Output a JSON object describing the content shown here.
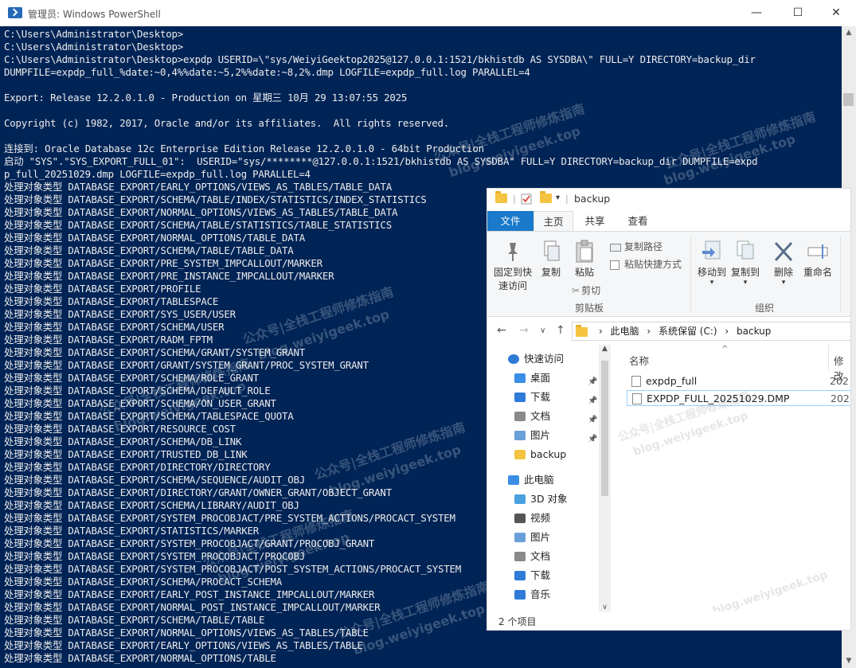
{
  "powershell": {
    "title": "管理员: Windows PowerShell",
    "controls": {
      "minimize": "—",
      "maximize": "☐",
      "close": "✕"
    },
    "lines": [
      "C:\\Users\\Administrator\\Desktop>",
      "C:\\Users\\Administrator\\Desktop>",
      "C:\\Users\\Administrator\\Desktop>expdp USERID=\\\"sys/WeiyiGeektop2025@127.0.0.1:1521/bkhistdb AS SYSDBA\\\" FULL=Y DIRECTORY=backup_dir",
      "DUMPFILE=expdp_full_%date:~0,4%%date:~5,2%%date:~8,2%.dmp LOGFILE=expdp_full.log PARALLEL=4",
      "",
      "Export: Release 12.2.0.1.0 - Production on 星期三 10月 29 13:07:55 2025",
      "",
      "Copyright (c) 1982, 2017, Oracle and/or its affiliates.  All rights reserved.",
      "",
      "连接到: Oracle Database 12c Enterprise Edition Release 12.2.0.1.0 - 64bit Production",
      "启动 \"SYS\".\"SYS_EXPORT_FULL_01\":  USERID=\"sys/********@127.0.0.1:1521/bkhistdb AS SYSDBA\" FULL=Y DIRECTORY=backup_dir DUMPFILE=expd",
      "p_full_20251029.dmp LOGFILE=expdp_full.log PARALLEL=4",
      "处理对象类型 DATABASE_EXPORT/EARLY_OPTIONS/VIEWS_AS_TABLES/TABLE_DATA",
      "处理对象类型 DATABASE_EXPORT/SCHEMA/TABLE/INDEX/STATISTICS/INDEX_STATISTICS",
      "处理对象类型 DATABASE_EXPORT/NORMAL_OPTIONS/VIEWS_AS_TABLES/TABLE_DATA",
      "处理对象类型 DATABASE_EXPORT/SCHEMA/TABLE/STATISTICS/TABLE_STATISTICS",
      "处理对象类型 DATABASE_EXPORT/NORMAL_OPTIONS/TABLE_DATA",
      "处理对象类型 DATABASE_EXPORT/SCHEMA/TABLE/TABLE_DATA",
      "处理对象类型 DATABASE_EXPORT/PRE_SYSTEM_IMPCALLOUT/MARKER",
      "处理对象类型 DATABASE_EXPORT/PRE_INSTANCE_IMPCALLOUT/MARKER",
      "处理对象类型 DATABASE_EXPORT/PROFILE",
      "处理对象类型 DATABASE_EXPORT/TABLESPACE",
      "处理对象类型 DATABASE_EXPORT/SYS_USER/USER",
      "处理对象类型 DATABASE_EXPORT/SCHEMA/USER",
      "处理对象类型 DATABASE_EXPORT/RADM_FPTM",
      "处理对象类型 DATABASE_EXPORT/SCHEMA/GRANT/SYSTEM_GRANT",
      "处理对象类型 DATABASE_EXPORT/GRANT/SYSTEM_GRANT/PROC_SYSTEM_GRANT",
      "处理对象类型 DATABASE_EXPORT/SCHEMA/ROLE_GRANT",
      "处理对象类型 DATABASE_EXPORT/SCHEMA/DEFAULT_ROLE",
      "处理对象类型 DATABASE_EXPORT/SCHEMA/ON_USER_GRANT",
      "处理对象类型 DATABASE_EXPORT/SCHEMA/TABLESPACE_QUOTA",
      "处理对象类型 DATABASE_EXPORT/RESOURCE_COST",
      "处理对象类型 DATABASE_EXPORT/SCHEMA/DB_LINK",
      "处理对象类型 DATABASE_EXPORT/TRUSTED_DB_LINK",
      "处理对象类型 DATABASE_EXPORT/DIRECTORY/DIRECTORY",
      "处理对象类型 DATABASE_EXPORT/SCHEMA/SEQUENCE/AUDIT_OBJ",
      "处理对象类型 DATABASE_EXPORT/DIRECTORY/GRANT/OWNER_GRANT/OBJECT_GRANT",
      "处理对象类型 DATABASE_EXPORT/SCHEMA/LIBRARY/AUDIT_OBJ",
      "处理对象类型 DATABASE_EXPORT/SYSTEM_PROCOBJACT/PRE_SYSTEM_ACTIONS/PROCACT_SYSTEM",
      "处理对象类型 DATABASE_EXPORT/STATISTICS/MARKER",
      "处理对象类型 DATABASE_EXPORT/SYSTEM_PROCOBJACT/GRANT/PROCOBJ_GRANT",
      "处理对象类型 DATABASE_EXPORT/SYSTEM_PROCOBJACT/PROCOBJ",
      "处理对象类型 DATABASE_EXPORT/SYSTEM_PROCOBJACT/POST_SYSTEM_ACTIONS/PROCACT_SYSTEM",
      "处理对象类型 DATABASE_EXPORT/SCHEMA/PROCACT_SCHEMA",
      "处理对象类型 DATABASE_EXPORT/EARLY_POST_INSTANCE_IMPCALLOUT/MARKER",
      "处理对象类型 DATABASE_EXPORT/NORMAL_POST_INSTANCE_IMPCALLOUT/MARKER",
      "处理对象类型 DATABASE_EXPORT/SCHEMA/TABLE/TABLE",
      "处理对象类型 DATABASE_EXPORT/NORMAL_OPTIONS/VIEWS_AS_TABLES/TABLE",
      "处理对象类型 DATABASE_EXPORT/EARLY_OPTIONS/VIEWS_AS_TABLES/TABLE",
      "处理对象类型 DATABASE_EXPORT/NORMAL_OPTIONS/TABLE"
    ]
  },
  "watermarks": [
    "公众号|全栈工程师修炼指南",
    "blog.weiyigeek.top"
  ],
  "explorer": {
    "title": "backup",
    "qa_dropdown": "▾",
    "tabs": {
      "file": "文件",
      "home": "主页",
      "share": "共享",
      "view": "查看"
    },
    "ribbon": {
      "pin": "固定到快\n速访问",
      "copy": "复制",
      "paste": "粘贴",
      "copy_path": "复制路径",
      "paste_shortcut": "粘贴快捷方式",
      "cut": "剪切",
      "clipboard_group": "剪贴板",
      "move_to": "移动到",
      "copy_to": "复制到",
      "delete": "删除",
      "rename": "重命名",
      "organize_group": "组织",
      "more_arrow": "▾"
    },
    "address": {
      "segments": [
        "此电脑",
        "系统保留 (C:)",
        "backup"
      ],
      "separator": "›"
    },
    "nav_items": [
      {
        "label": "快速访问",
        "icon": "star-icon",
        "pinned": false
      },
      {
        "label": "桌面",
        "icon": "desktop-icon",
        "pinned": true
      },
      {
        "label": "下载",
        "icon": "download-icon",
        "pinned": true
      },
      {
        "label": "文档",
        "icon": "document-icon",
        "pinned": true
      },
      {
        "label": "图片",
        "icon": "pictures-icon",
        "pinned": true
      },
      {
        "label": "backup",
        "icon": "folder-icon",
        "pinned": false
      },
      {
        "label": "此电脑",
        "icon": "computer-icon",
        "pinned": false
      },
      {
        "label": "3D 对象",
        "icon": "3d-objects-icon",
        "pinned": false
      },
      {
        "label": "视频",
        "icon": "video-icon",
        "pinned": false
      },
      {
        "label": "图片",
        "icon": "pictures-icon",
        "pinned": false
      },
      {
        "label": "文档",
        "icon": "document-icon",
        "pinned": false
      },
      {
        "label": "下载",
        "icon": "download-icon",
        "pinned": false
      },
      {
        "label": "音乐",
        "icon": "music-icon",
        "pinned": false
      }
    ],
    "columns": {
      "name": "名称",
      "modified": "修改"
    },
    "files": [
      {
        "name": "expdp_full",
        "date": "202",
        "selected": false
      },
      {
        "name": "EXPDP_FULL_20251029.DMP",
        "date": "202",
        "selected": true
      }
    ],
    "status": "2 个项目"
  }
}
